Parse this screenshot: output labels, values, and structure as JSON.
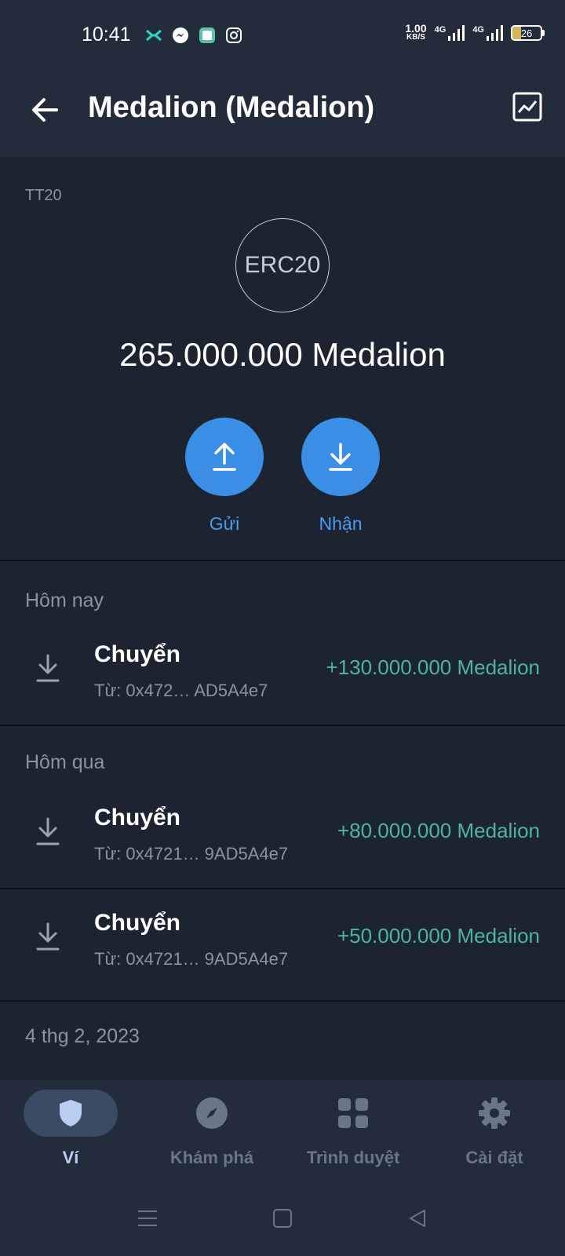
{
  "status_bar": {
    "time": "10:41",
    "speed_value": "1.00",
    "speed_unit": "KB/S",
    "network_1": "4G",
    "network_2": "4G",
    "battery": "26"
  },
  "app_bar": {
    "title": "Medalion (Medalion)"
  },
  "token": {
    "network": "TT20",
    "logo_text": "ERC20",
    "balance": "265.000.000 Medalion"
  },
  "actions": {
    "send_label": "Gửi",
    "receive_label": "Nhận"
  },
  "transactions": [
    {
      "date_header": "Hôm nay",
      "items": [
        {
          "title": "Chuyển",
          "from": "Từ: 0x472…  AD5A4e7",
          "amount": "+130.000.000 Medalion"
        }
      ]
    },
    {
      "date_header": "Hôm qua",
      "items": [
        {
          "title": "Chuyển",
          "from": "Từ: 0x4721…  9AD5A4e7",
          "amount": "+80.000.000 Medalion"
        },
        {
          "title": "Chuyển",
          "from": "Từ: 0x4721…  9AD5A4e7",
          "amount": "+50.000.000 Medalion"
        }
      ]
    },
    {
      "date_header": "4 thg 2, 2023",
      "items": []
    }
  ],
  "bottom_nav": {
    "items": [
      {
        "label": "Ví",
        "icon": "shield-icon",
        "active": true
      },
      {
        "label": "Khám phá",
        "icon": "compass-icon",
        "active": false
      },
      {
        "label": "Trình duyệt",
        "icon": "grid-icon",
        "active": false
      },
      {
        "label": "Cài đặt",
        "icon": "gear-icon",
        "active": false
      }
    ]
  },
  "colors": {
    "accent_blue": "#3a8ee6",
    "amount_green": "#4fb3a1",
    "background": "#1b2430"
  }
}
